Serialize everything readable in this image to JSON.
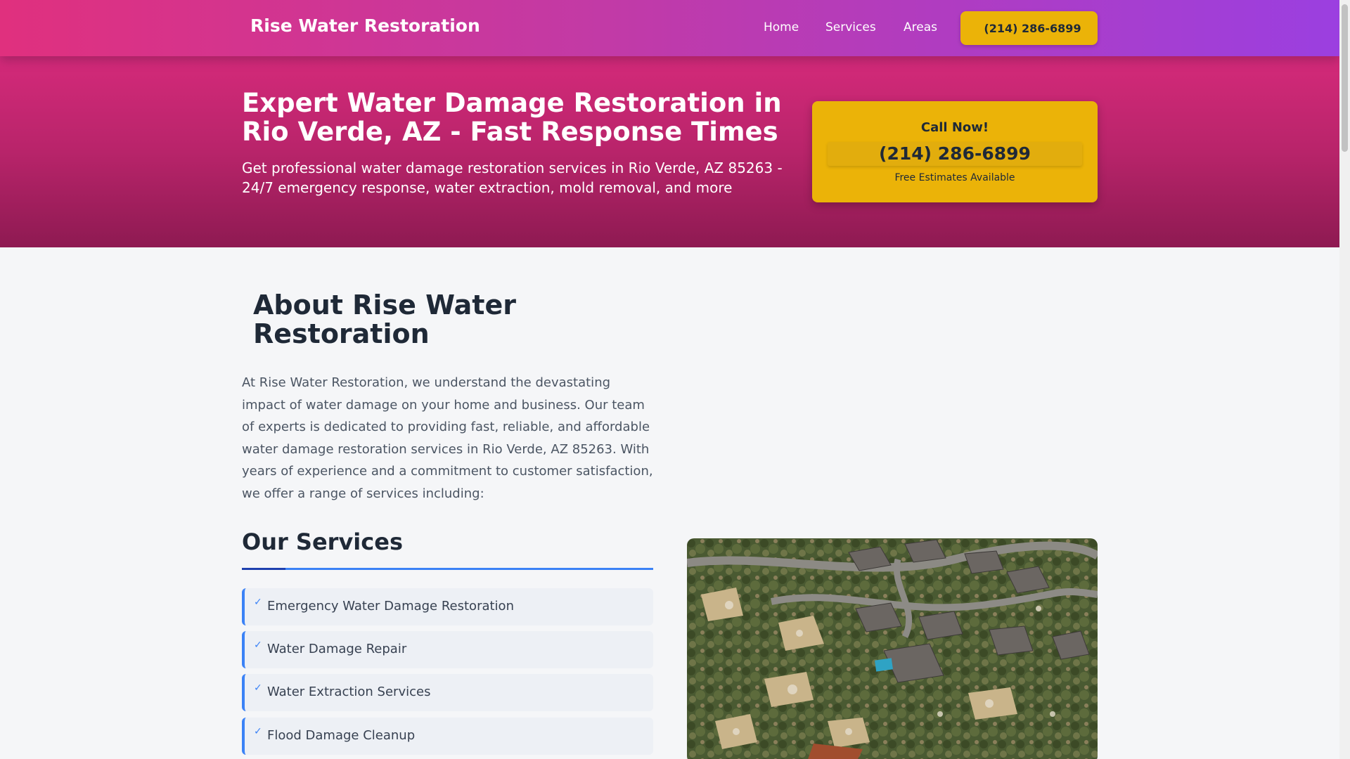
{
  "header": {
    "brand": "Rise Water Restoration",
    "nav": {
      "home": "Home",
      "services": "Services",
      "areas": "Areas"
    },
    "phone_button": "(214) 286-6899"
  },
  "hero": {
    "title": "Expert Water Damage Restoration in Rio Verde, AZ - Fast Response Times",
    "subtitle": "Get professional water damage restoration services in Rio Verde, AZ 85263 - 24/7 emergency response, water extraction, mold removal, and more",
    "call_card": {
      "title": "Call Now!",
      "phone": "(214) 286-6899",
      "note": "Free Estimates Available"
    }
  },
  "about": {
    "title": "About Rise Water Restoration",
    "text": "At Rise Water Restoration, we understand the devastating impact of water damage on your home and business. Our team of experts is dedicated to providing fast, reliable, and affordable water damage restoration services in Rio Verde, AZ 85263. With years of experience and a commitment to customer satisfaction, we offer a range of services including:"
  },
  "services": {
    "title": "Our Services",
    "check": "✓",
    "items": [
      "Emergency Water Damage Restoration",
      "Water Damage Repair",
      "Water Extraction Services",
      "Flood Damage Cleanup"
    ]
  },
  "colors": {
    "header_gradient": [
      "#e0307e",
      "#9b3fe0"
    ],
    "hero_gradient": [
      "#d42a7a",
      "#8e1a52"
    ],
    "accent_yellow": "#ebb308",
    "accent_blue": "#3b82f6"
  },
  "photo": {
    "subject": "aerial-storm-damaged-neighborhood"
  }
}
